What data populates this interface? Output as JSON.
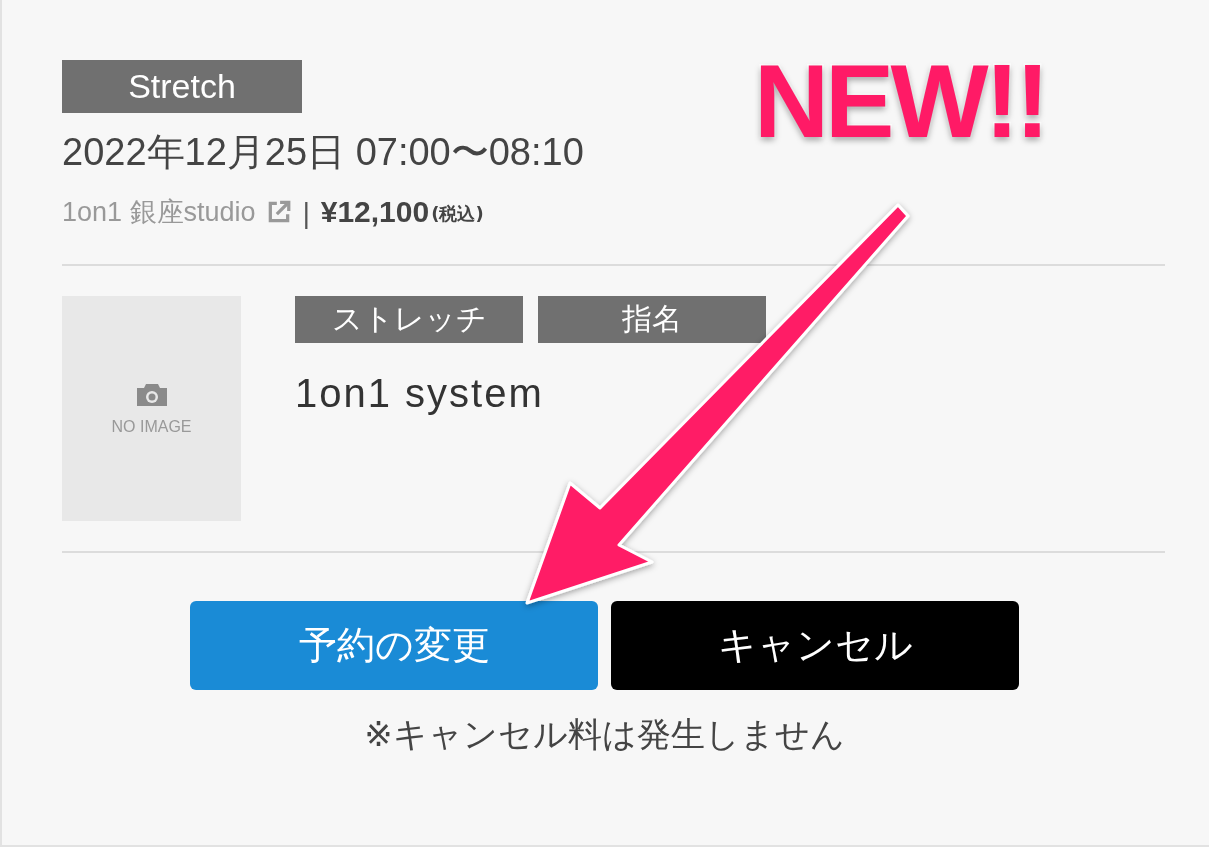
{
  "category_tag": "Stretch",
  "datetime": "2022年12月25日 07:00〜08:10",
  "studio": "1on1 銀座studio",
  "separator": "|",
  "price": "¥12,100",
  "tax_note": "(税込)",
  "staff": {
    "image_text": "NO IMAGE",
    "tags": [
      "ストレッチ",
      "指名"
    ],
    "name": "1on1 system"
  },
  "buttons": [
    {
      "label": "予約の変更",
      "kind": "primary"
    },
    {
      "label": "キャンセル",
      "kind": "dark"
    }
  ],
  "note": "※キャンセル料は発生しません",
  "annotation": {
    "text": "NEW!!"
  }
}
